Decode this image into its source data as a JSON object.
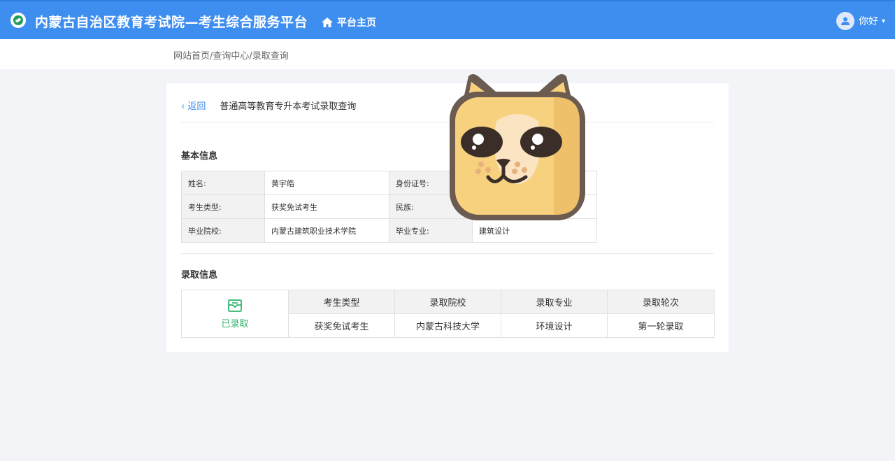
{
  "header": {
    "site_title": "内蒙古自治区教育考试院—考生综合服务平台",
    "home_label": "平台主页",
    "user_greeting": "你好",
    "colors": {
      "bar": "#3e8ef0",
      "logo_green": "#1e9e5a"
    }
  },
  "breadcrumb": "网站首页/查询中心/录取查询",
  "card": {
    "back_label": "返回",
    "page_title": "普通高等教育专升本考试录取查询",
    "basic_section": "基本信息",
    "basic_rows": [
      {
        "l1": "姓名:",
        "v1": "黄宇皓",
        "l2": "身份证号:",
        "v2": ""
      },
      {
        "l1": "考生类型:",
        "v1": "获奖免试考生",
        "l2": "民族:",
        "v2": ""
      },
      {
        "l1": "毕业院校:",
        "v1": "内蒙古建筑职业技术学院",
        "l2": "毕业专业:",
        "v2": "建筑设计"
      }
    ],
    "admit_section": "录取信息",
    "admit_status": "已录取",
    "admit_headers": [
      "考生类型",
      "录取院校",
      "录取专业",
      "录取轮次"
    ],
    "admit_values": [
      "获奖免试考生",
      "内蒙古科技大学",
      "环境设计",
      "第一轮录取"
    ],
    "status_color": "#2fb36b"
  },
  "icons": [
    "home-icon",
    "user-avatar-icon",
    "chevron-down-icon",
    "chevron-left-icon",
    "mail-open-icon",
    "cat-sticker"
  ]
}
